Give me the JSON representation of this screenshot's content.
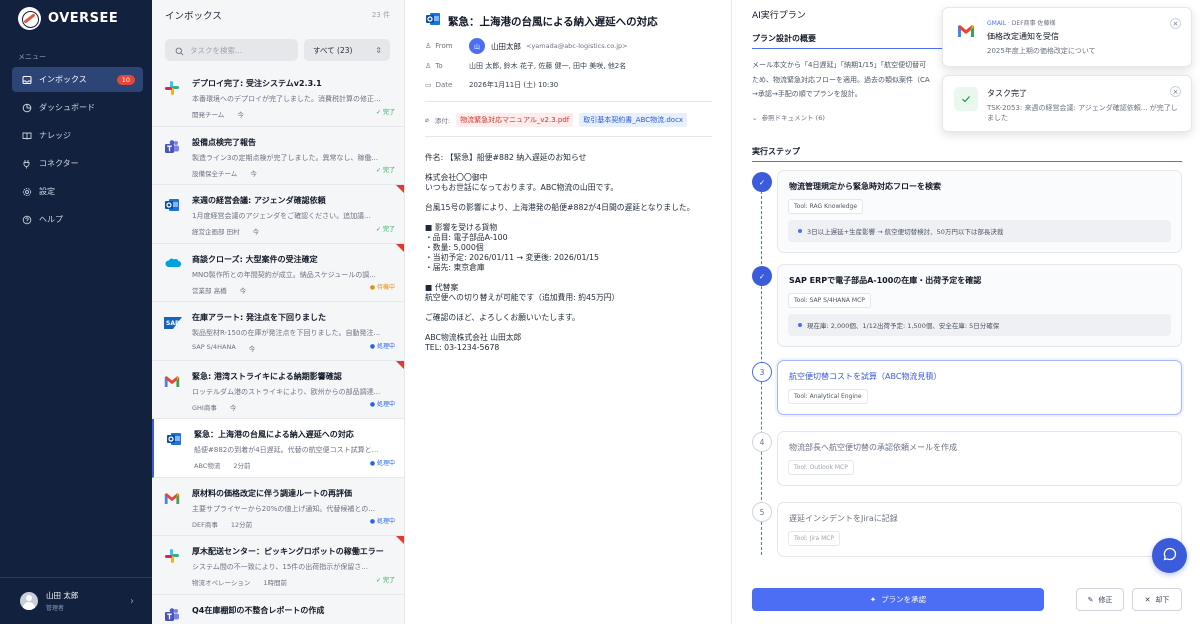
{
  "brand": {
    "name": "OVERSEE"
  },
  "sidebar": {
    "caption": "メニュー",
    "items": [
      {
        "label": "インボックス",
        "icon": "inbox-icon",
        "badge": "10"
      },
      {
        "label": "ダッシュボード",
        "icon": "dashboard-icon"
      },
      {
        "label": "ナレッジ",
        "icon": "book-icon"
      },
      {
        "label": "コネクター",
        "icon": "plug-icon"
      },
      {
        "label": "設定",
        "icon": "gear-icon"
      },
      {
        "label": "ヘルプ",
        "icon": "help-icon"
      }
    ],
    "user": {
      "name": "山田 太郎",
      "role": "管理者"
    }
  },
  "inbox": {
    "title": "インボックス",
    "count": "23 件",
    "search_placeholder": "タスクを検索...",
    "filter": "すべて (23)",
    "items": [
      {
        "app": "slack",
        "subject": "デプロイ完了: 受注システムv2.3.1",
        "preview": "本番環境へのデプロイが完了しました。消費税計算の修正...",
        "sender": "開発チーム",
        "time": "今",
        "status": "完了",
        "status_type": "done",
        "flag": false
      },
      {
        "app": "teams",
        "subject": "設備点検完了報告",
        "preview": "製造ライン3の定期点検が完了しました。異常なし、稼働...",
        "sender": "設備保全チーム",
        "time": "今",
        "status": "完了",
        "status_type": "done",
        "flag": false
      },
      {
        "app": "outlook",
        "subject": "来週の経営会議: アジェンダ確認依頼",
        "preview": "1月度経営会議のアジェンダをご確認ください。追加議...",
        "sender": "経営企画部 田村",
        "time": "今",
        "status": "完了",
        "status_type": "done",
        "flag": true
      },
      {
        "app": "salesforce",
        "subject": "商談クローズ: 大型案件の受注確定",
        "preview": "MNO製作所との年間契約が成立。納品スケジュールの調...",
        "sender": "営業部 高橋",
        "time": "今",
        "status": "待機中",
        "status_type": "wait",
        "flag": true
      },
      {
        "app": "sap",
        "subject": "在庫アラート: 発注点を下回りました",
        "preview": "製品型材R-150の在庫が発注点を下回りました。自動発注...",
        "sender": "SAP S/4HANA",
        "time": "今",
        "status": "処理中",
        "status_type": "proc",
        "flag": false
      },
      {
        "app": "gmail",
        "subject": "緊急: 港湾ストライキによる納期影響確認",
        "preview": "ロッテルダム港のストライキにより、欧州からの部品調達...",
        "sender": "GHI商事",
        "time": "今",
        "status": "処理中",
        "status_type": "proc",
        "flag": true
      },
      {
        "app": "outlook",
        "subject": "緊急：上海港の台風による納入遅延への対応",
        "preview": "船便#882の到着が4日遅延。代替の航空便コスト試算と...",
        "sender": "ABC物流",
        "time": "2分前",
        "status": "処理中",
        "status_type": "proc",
        "flag": false,
        "selected": true
      },
      {
        "app": "gmail",
        "subject": "原材料の価格改定に伴う調達ルートの再評価",
        "preview": "主要サプライヤーから20%の値上げ通知。代替候補との...",
        "sender": "DEF商事",
        "time": "12分前",
        "status": "処理中",
        "status_type": "proc",
        "flag": false
      },
      {
        "app": "slack",
        "subject": "厚木配送センター：ピッキングロボットの稼働エラー",
        "preview": "システム間の不一致により、15件の出荷指示が保留さ...",
        "sender": "物流オペレーション",
        "time": "1時間前",
        "status": "完了",
        "status_type": "done",
        "flag": true
      },
      {
        "app": "teams",
        "subject": "Q4在庫棚卸の不整合レポートの作成",
        "preview": "",
        "sender": "",
        "time": "",
        "status": "",
        "status_type": "",
        "flag": false
      }
    ]
  },
  "email": {
    "subject": "緊急：上海港の台風による納入遅延への対応",
    "from_label": "From",
    "from_initial": "山",
    "from_name": "山田太郎",
    "from_addr": "<yamada@abc-logistics.co.jp>",
    "to_label": "To",
    "to": "山田 太郎, 鈴木 花子, 佐藤 健一, 田中 美咲, 他2名",
    "date_label": "Date",
    "date": "2026年1月11日 (土) 10:30",
    "attach_label": "添付:",
    "attachments": [
      "物流緊急対応マニュアル_v2.3.pdf",
      "取引基本契約書_ABC物流.docx"
    ],
    "body": [
      "件名: 【緊急】船便#882 納入遅延のお知らせ",
      "",
      "株式会社〇〇御中",
      "いつもお世話になっております。ABC物流の山田です。",
      "",
      "台風15号の影響により、上海港発の船便#882が4日間の遅延となりました。",
      "",
      "■ 影響を受ける貨物",
      "・品目: 電子部品A-100",
      "・数量: 5,000個",
      "・当初予定: 2026/01/11 → 変更後: 2026/01/15",
      "・届先: 東京倉庫",
      "",
      "■ 代替案",
      "航空便への切り替えが可能です（追加費用: 約45万円）",
      "",
      "ご確認のほど、よろしくお願いいたします。",
      "",
      "ABC物流株式会社 山田太郎",
      "TEL: 03-1234-5678"
    ]
  },
  "plan": {
    "header": "AI実行プラン",
    "overview_title": "プラン設計の概要",
    "overview_lines": [
      "メール本文から「4日遅延」「納期1/15」「航空便切替可",
      "ため、物流緊急対応フローを適用。過去の類似案件（CA",
      "→承認→手配の順でプランを設計。"
    ],
    "ref_docs": "参照ドキュメント (6)",
    "steps_title": "実行ステップ",
    "steps": [
      {
        "n": "1",
        "state": "done",
        "title": "物流管理規定から緊急時対応フローを検索",
        "tool": "Tool: RAG Knowledge",
        "result": "3日以上遅延+生産影響 → 航空便切替検討、50万円以下は部長決裁"
      },
      {
        "n": "2",
        "state": "done",
        "title": "SAP ERPで電子部品A-100の在庫・出荷予定を確認",
        "tool": "Tool: SAP S/4HANA MCP",
        "result": "現在庫: 2,000個、1/12出荷予定: 1,500個、安全在庫: 5日分確保"
      },
      {
        "n": "3",
        "state": "cur",
        "title": "航空便切替コストを試算（ABC物流見積）",
        "tool": "Tool: Analytical Engine",
        "result": ""
      },
      {
        "n": "4",
        "state": "todo",
        "title": "物流部長へ航空便切替の承認依頼メールを作成",
        "tool": "Tool: Outlook MCP",
        "result": ""
      },
      {
        "n": "5",
        "state": "todo",
        "title": "遅延インシデントをJiraに記録",
        "tool": "Tool: Jira MCP",
        "result": ""
      }
    ],
    "approve": "プランを承認",
    "edit": "修正",
    "reject": "却下"
  },
  "toasts": [
    {
      "source": "GMAIL",
      "source_detail": "DEF商事 佐藤様",
      "title": "価格改定通知を受信",
      "body": "2025年度上期の価格改定について"
    },
    {
      "source": "",
      "source_detail": "",
      "title": "タスク完了",
      "body": "TSK-2053: 来週の経営会議: アジェンダ確認依頼... が完了しました"
    }
  ],
  "colors": {
    "accent": "#4c6ef5",
    "sidebar": "#12213d",
    "flag": "#e0392e"
  }
}
